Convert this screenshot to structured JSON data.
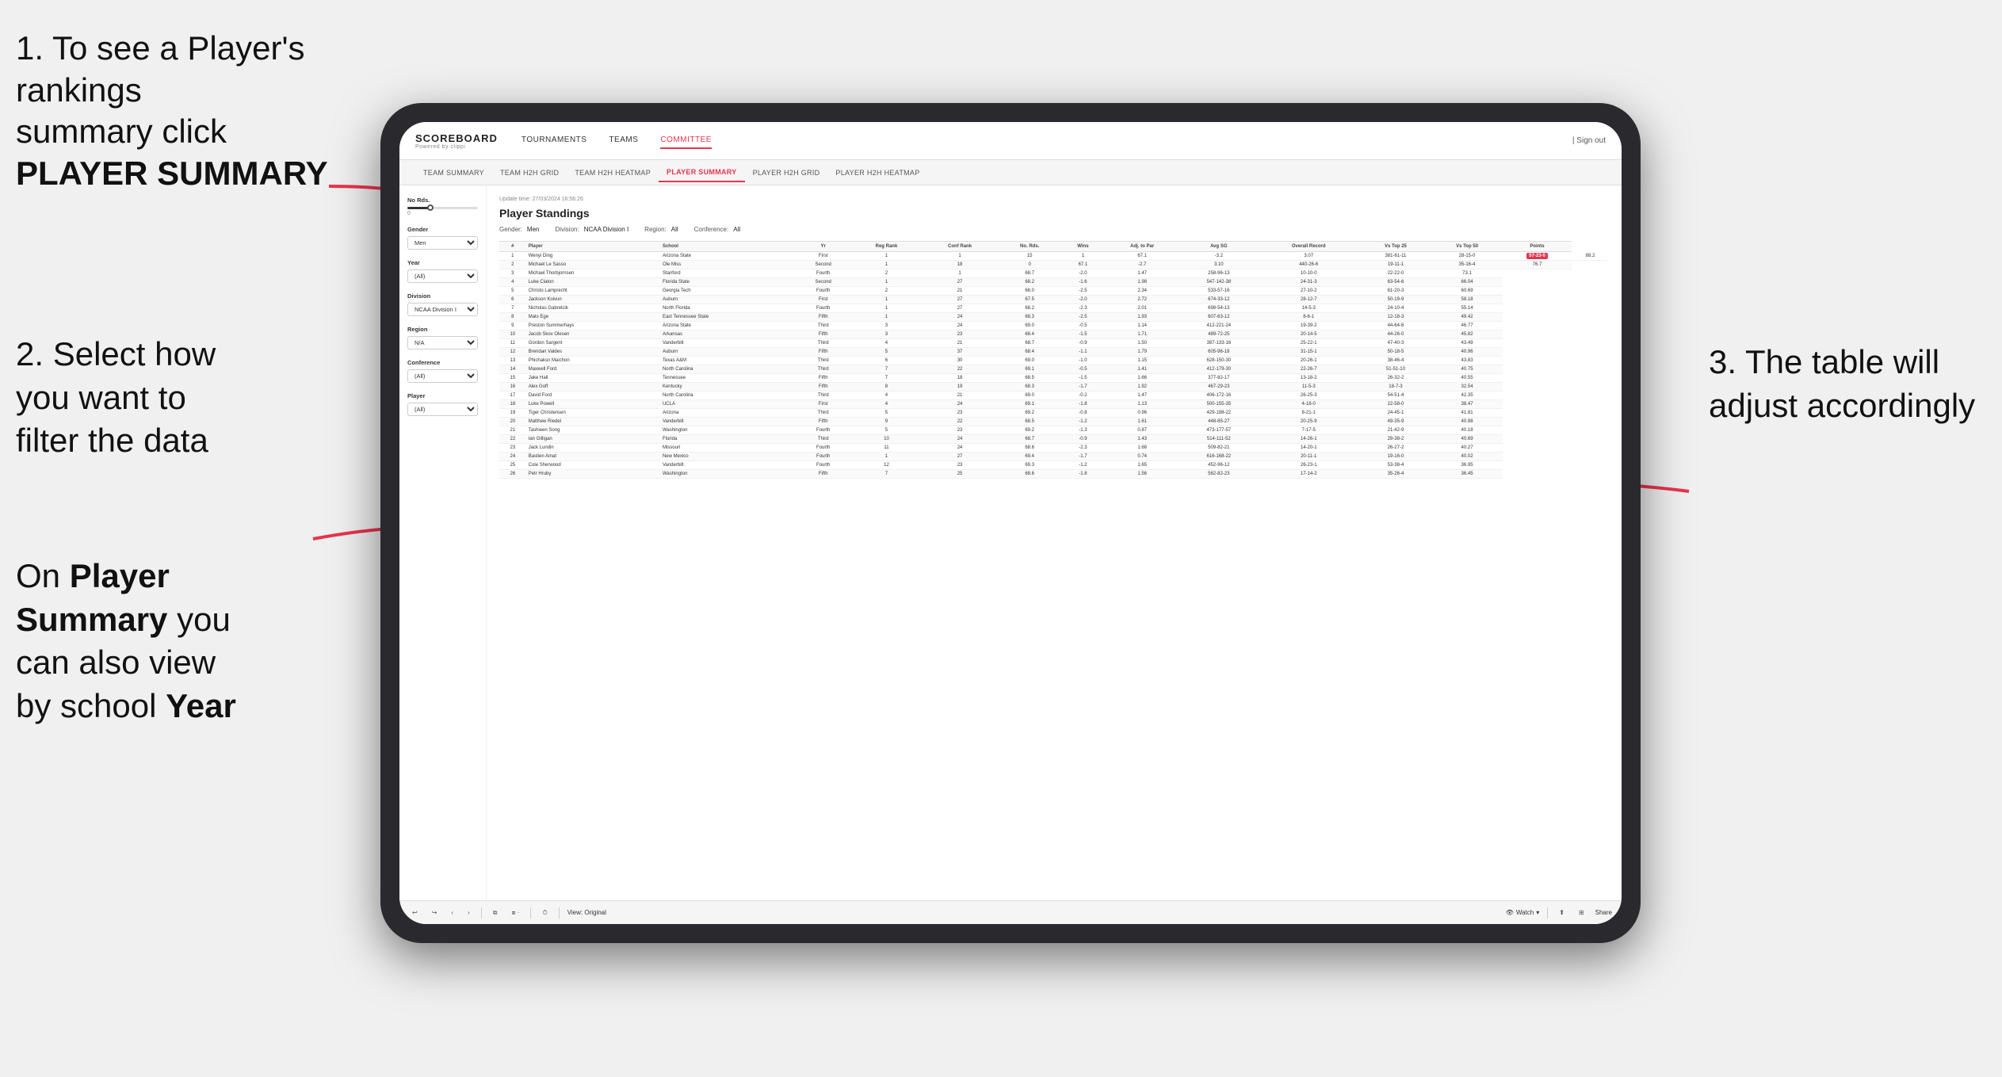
{
  "page": {
    "background": "#f0f0f0"
  },
  "annotations": {
    "top_left": {
      "number": "1.",
      "line1": "To see a Player's rankings",
      "line2": "summary click",
      "bold_text": "PLAYER SUMMARY"
    },
    "middle_left": {
      "number": "2.",
      "line1": "Select how",
      "line2": "you want to",
      "line3": "filter the data"
    },
    "bottom_left": {
      "line1": "On",
      "bold1": "Player",
      "line2": "Summary",
      "line3": "you",
      "line4": "can also view",
      "line5": "by school",
      "bold2": "Year"
    },
    "right": {
      "number": "3.",
      "line1": "The table will",
      "line2": "adjust accordingly"
    }
  },
  "app": {
    "logo": "SCOREBOARD",
    "logo_sub": "Powered by clippi",
    "nav": [
      {
        "label": "TOURNAMENTS",
        "active": false
      },
      {
        "label": "TEAMS",
        "active": false
      },
      {
        "label": "COMMITTEE",
        "active": true
      }
    ],
    "header_right": "| Sign out",
    "sub_nav": [
      {
        "label": "TEAM SUMMARY",
        "active": false
      },
      {
        "label": "TEAM H2H GRID",
        "active": false
      },
      {
        "label": "TEAM H2H HEATMAP",
        "active": false
      },
      {
        "label": "PLAYER SUMMARY",
        "active": true
      },
      {
        "label": "PLAYER H2H GRID",
        "active": false
      },
      {
        "label": "PLAYER H2H HEATMAP",
        "active": false
      }
    ]
  },
  "sidebar": {
    "rds_label": "No Rds.",
    "gender_label": "Gender",
    "gender_value": "Men",
    "year_label": "Year",
    "year_value": "(All)",
    "division_label": "Division",
    "division_value": "NCAA Division I",
    "region_label": "Region",
    "region_value": "N/A",
    "conference_label": "Conference",
    "conference_value": "(All)",
    "player_label": "Player",
    "player_value": "(All)"
  },
  "table": {
    "update_time": "Update time: 27/03/2024 16:56:26",
    "title": "Player Standings",
    "gender_label": "Gender:",
    "gender_value": "Men",
    "division_label": "Division:",
    "division_value": "NCAA Division I",
    "region_label": "Region:",
    "region_value": "All",
    "conference_label": "Conference:",
    "conference_value": "All",
    "columns": [
      "#",
      "Player",
      "School",
      "Yr",
      "Reg Rank",
      "Conf Rank",
      "No. Rds.",
      "Wins",
      "Adj. to Par",
      "Avg SG",
      "Overall Record",
      "Vs Top 25",
      "Vs Top 50",
      "Points"
    ],
    "rows": [
      [
        "1",
        "Wenyi Ding",
        "Arizona State",
        "First",
        "1",
        "1",
        "15",
        "1",
        "67.1",
        "-3.2",
        "3.07",
        "381-61-11",
        "28-15-0",
        "57-23-0",
        "88.2"
      ],
      [
        "2",
        "Michael Le Sasso",
        "Ole Miss",
        "Second",
        "1",
        "18",
        "0",
        "67.1",
        "-2.7",
        "3.10",
        "440-26-6",
        "19-11-1",
        "35-16-4",
        "76.7"
      ],
      [
        "3",
        "Michael Thorbjornsen",
        "Stanford",
        "Fourth",
        "2",
        "1",
        "68.7",
        "-2.0",
        "1.47",
        "258-96-13",
        "10-10-0",
        "22-22-0",
        "73.1"
      ],
      [
        "4",
        "Luke Claton",
        "Florida State",
        "Second",
        "1",
        "27",
        "68.2",
        "-1.6",
        "1.98",
        "547-142-38",
        "24-31-3",
        "63-54-6",
        "66.04"
      ],
      [
        "5",
        "Christo Lamprecht",
        "Georgia Tech",
        "Fourth",
        "2",
        "21",
        "68.0",
        "-2.5",
        "2.34",
        "533-57-16",
        "27-10-2",
        "61-20-3",
        "60.69"
      ],
      [
        "6",
        "Jackson Koivun",
        "Auburn",
        "First",
        "1",
        "27",
        "67.5",
        "-2.0",
        "2.72",
        "674-33-12",
        "28-12-7",
        "50-19-9",
        "58.18"
      ],
      [
        "7",
        "Nicholas Gabrelcik",
        "North Florida",
        "Fourth",
        "1",
        "27",
        "68.2",
        "-2.3",
        "2.01",
        "698-54-13",
        "14-5-3",
        "24-10-4",
        "55.14"
      ],
      [
        "8",
        "Mats Ege",
        "East Tennessee State",
        "Fifth",
        "1",
        "24",
        "68.3",
        "-2.5",
        "1.93",
        "607-63-12",
        "8-6-1",
        "12-18-3",
        "49.42"
      ],
      [
        "9",
        "Preston Summerhays",
        "Arizona State",
        "Third",
        "3",
        "24",
        "69.0",
        "-0.5",
        "1.14",
        "412-221-24",
        "19-39-2",
        "44-64-6",
        "46.77"
      ],
      [
        "10",
        "Jacob Skov Olesen",
        "Arkansas",
        "Fifth",
        "3",
        "23",
        "68.4",
        "-1.5",
        "1.71",
        "489-72-25",
        "20-14-5",
        "44-26-0",
        "45.82"
      ],
      [
        "11",
        "Gordon Sargent",
        "Vanderbilt",
        "Third",
        "4",
        "21",
        "68.7",
        "-0.9",
        "1.50",
        "387-133-16",
        "25-22-1",
        "47-40-3",
        "43.49"
      ],
      [
        "12",
        "Brendan Valdes",
        "Auburn",
        "Fifth",
        "5",
        "37",
        "68.4",
        "-1.1",
        "1.79",
        "605-96-18",
        "31-15-1",
        "50-18-5",
        "40.96"
      ],
      [
        "13",
        "Phichaksn Maichon",
        "Texas A&M",
        "Third",
        "6",
        "30",
        "69.0",
        "-1.0",
        "1.15",
        "628-150-30",
        "20-26-1",
        "38-46-4",
        "43.83"
      ],
      [
        "14",
        "Maxwell Ford",
        "North Carolina",
        "Third",
        "7",
        "22",
        "69.1",
        "-0.5",
        "1.41",
        "412-179-30",
        "22-26-7",
        "51-51-10",
        "40.75"
      ],
      [
        "15",
        "Jake Hall",
        "Tennessee",
        "Fifth",
        "7",
        "18",
        "68.5",
        "-1.5",
        "1.66",
        "377-82-17",
        "13-18-2",
        "26-32-2",
        "40.55"
      ],
      [
        "16",
        "Alex Goff",
        "Kentucky",
        "Fifth",
        "8",
        "19",
        "68.3",
        "-1.7",
        "1.92",
        "467-29-23",
        "11-5-3",
        "18-7-3",
        "32.54"
      ],
      [
        "17",
        "David Ford",
        "North Carolina",
        "Third",
        "4",
        "21",
        "69.0",
        "-0.2",
        "1.47",
        "406-172-16",
        "26-25-3",
        "54-51-4",
        "42.35"
      ],
      [
        "18",
        "Luke Powell",
        "UCLA",
        "First",
        "4",
        "24",
        "69.1",
        "-1.8",
        "1.13",
        "500-155-35",
        "4-18-0",
        "22-58-0",
        "38.47"
      ],
      [
        "19",
        "Tiger Christensen",
        "Arizona",
        "Third",
        "5",
        "23",
        "69.2",
        "-0.8",
        "0.96",
        "429-198-22",
        "8-21-1",
        "24-45-1",
        "41.81"
      ],
      [
        "20",
        "Matthew Riedel",
        "Vanderbilt",
        "Fifth",
        "9",
        "22",
        "68.5",
        "-1.2",
        "1.61",
        "448-85-27",
        "20-25-9",
        "49-35-9",
        "40.98"
      ],
      [
        "21",
        "Tashieen Song",
        "Washington",
        "Fourth",
        "5",
        "23",
        "69.2",
        "-1.3",
        "0.87",
        "473-177-57",
        "7-17-5",
        "21-42-9",
        "40.18"
      ],
      [
        "22",
        "Ian Gilligan",
        "Florida",
        "Third",
        "10",
        "24",
        "68.7",
        "-0.9",
        "1.43",
        "514-111-52",
        "14-26-1",
        "29-38-2",
        "40.69"
      ],
      [
        "23",
        "Jack Lundin",
        "Missouri",
        "Fourth",
        "11",
        "24",
        "68.6",
        "-2.3",
        "1.68",
        "509-82-21",
        "14-20-1",
        "26-27-2",
        "40.27"
      ],
      [
        "24",
        "Bastien Amat",
        "New Mexico",
        "Fourth",
        "1",
        "27",
        "69.4",
        "-1.7",
        "0.74",
        "616-168-22",
        "20-11-1",
        "19-16-0",
        "40.02"
      ],
      [
        "25",
        "Cole Sherwood",
        "Vanderbilt",
        "Fourth",
        "12",
        "23",
        "69.3",
        "-1.2",
        "1.65",
        "452-96-12",
        "26-23-1",
        "53-38-4",
        "36.95"
      ],
      [
        "26",
        "Petr Hruby",
        "Washington",
        "Fifth",
        "7",
        "25",
        "68.6",
        "-1.8",
        "1.56",
        "562-82-23",
        "17-14-2",
        "35-26-4",
        "36.45"
      ]
    ]
  },
  "toolbar": {
    "view_label": "View: Original",
    "watch_label": "Watch",
    "share_label": "Share"
  }
}
